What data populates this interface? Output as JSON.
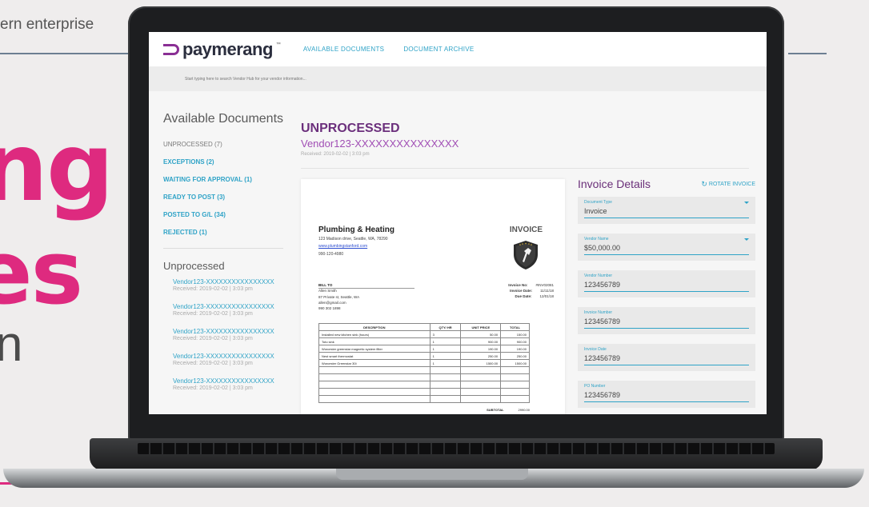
{
  "background": {
    "top_text": "ern enterprise",
    "big_line1": "ng",
    "big_line2": "es",
    "line3": "n"
  },
  "app": {
    "logo_text": "paymerang",
    "logo_tm": "™",
    "nav": [
      "AVAILABLE DOCUMENTS",
      "DOCUMENT ARCHIVE"
    ],
    "search_placeholder": "Start typing here to search Vendor Hub for your vendor information..."
  },
  "sidebar": {
    "title": "Available Documents",
    "items": [
      "UNPROCESSED (7)",
      "EXCEPTIONS (2)",
      "WAITING FOR APPROVAL (1)",
      "READY TO POST (3)",
      "POSTED TO G/L (34)",
      "REJECTED (1)"
    ],
    "sub_title": "Unprocessed",
    "vendors": [
      {
        "name": "Vendor123-XXXXXXXXXXXXXXXX",
        "received": "Received: 2019-02-02 | 3:03 pm"
      },
      {
        "name": "Vendor123-XXXXXXXXXXXXXXXX",
        "received": "Received: 2019-02-02 | 3:03 pm"
      },
      {
        "name": "Vendor123-XXXXXXXXXXXXXXXX",
        "received": "Received: 2019-02-02 | 3:03 pm"
      },
      {
        "name": "Vendor123-XXXXXXXXXXXXXXXX",
        "received": "Received: 2019-02-02 | 3:03 pm"
      },
      {
        "name": "Vendor123-XXXXXXXXXXXXXXXX",
        "received": "Received: 2019-02-02 | 3:03 pm"
      }
    ]
  },
  "main": {
    "title": "UNPROCESSED",
    "vendor": "Vendor123-XXXXXXXXXXXXXXX",
    "received": "Received: 2019-02-02 | 3:03 pm"
  },
  "invoice": {
    "company": "Plumbing & Heating",
    "address": "123 Madison drive, Seattle, WA, 78290",
    "website": "www.plumbingstanford.com",
    "phone": "990-120-4980",
    "label": "INVOICE",
    "bill_to": "BILL TO",
    "bill_name": "Allen Smith",
    "bill_addr": "87 Private st, Seattle, WA",
    "bill_email": "allen@gmail.com",
    "bill_phone": "990 302 1898",
    "meta": [
      {
        "label": "Invoice No:",
        "value": "#INV02081"
      },
      {
        "label": "Invoice Date:",
        "value": "11/11/18"
      },
      {
        "label": "Due Date:",
        "value": "12/01/18"
      }
    ],
    "columns": [
      "DESCRIPTION",
      "QTY/ HR",
      "UNIT PRICE",
      "TOTAL"
    ],
    "rows": [
      [
        "Installed new kitchen sink (hours)",
        "3",
        "50.00",
        "150.00"
      ],
      [
        "Toto sink",
        "1",
        "900.00",
        "900.00"
      ],
      [
        "Worcester greenstar magnetic system filter",
        "1",
        "190.00",
        "190.00"
      ],
      [
        "Nest smart thermostat",
        "1",
        "250.00",
        "250.00"
      ],
      [
        "Worcester Greenstar 30i",
        "1",
        "1500.00",
        "1500.00"
      ]
    ],
    "subtotal_label": "SUBTOTAL",
    "subtotal_value": "2990.00"
  },
  "details": {
    "title": "Invoice Details",
    "rotate_label": "ROTATE INVOICE",
    "fields": [
      {
        "label": "Document Type",
        "value": "Invoice"
      },
      {
        "label": "Vendor Name",
        "value": "$50,000.00"
      },
      {
        "label": "Vendor Number",
        "value": "123456789"
      },
      {
        "label": "Invoice Number",
        "value": "123456789"
      },
      {
        "label": "Invoice Date",
        "value": "123456789"
      },
      {
        "label": "PO Number",
        "value": "123456789"
      }
    ]
  },
  "colors": {
    "brand_purple": "#6b2f7c",
    "accent_blue": "#2fa3c7",
    "marketing_pink": "#de2a7f"
  }
}
